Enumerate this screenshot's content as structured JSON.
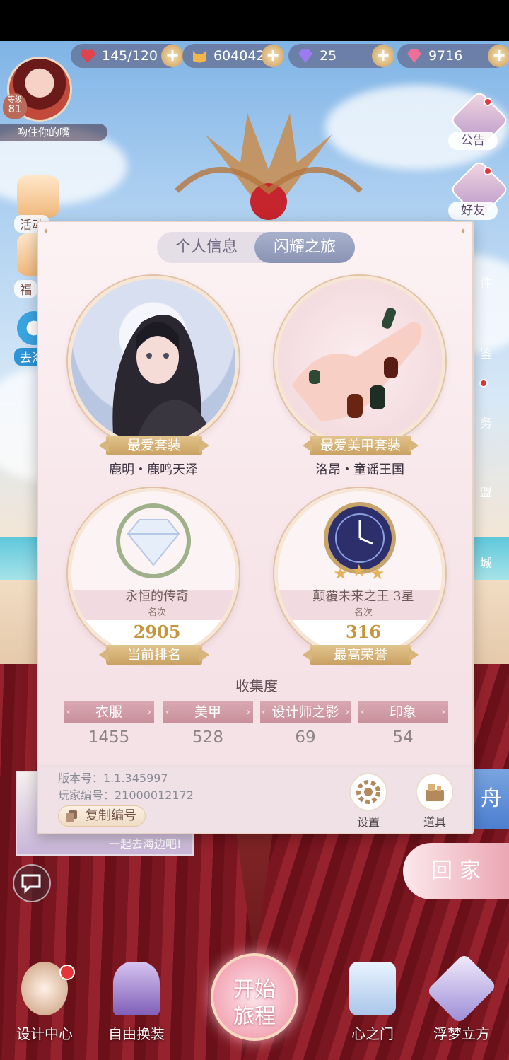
{
  "resources": [
    {
      "name": "stamina",
      "value": "145/120",
      "icon": "heart-icon",
      "color": "#e0434d"
    },
    {
      "name": "gold",
      "value": "604042",
      "icon": "cat-coin-icon",
      "color": "#f0b64a"
    },
    {
      "name": "diamond",
      "value": "25",
      "icon": "diamond-icon",
      "color": "#9a7cf0"
    },
    {
      "name": "crystal",
      "value": "9716",
      "icon": "pink-diamond-icon",
      "color": "#ef6f9b"
    }
  ],
  "player": {
    "level_label": "等级",
    "level": "81",
    "nickname": "吻住你的嘴"
  },
  "side_menu": [
    {
      "label": "公告",
      "icon": "notice-board-icon",
      "has_dot": true
    },
    {
      "label": "好友",
      "icon": "friend-icon",
      "has_dot": true
    }
  ],
  "side_partial": [
    "件",
    "鉴",
    "务",
    "盟",
    "城"
  ],
  "left_menu": [
    {
      "label": "活动",
      "icon": "event-icon"
    },
    {
      "label": "福",
      "icon": "gift-icon"
    },
    {
      "label": "去海",
      "icon": "float-ring-icon"
    }
  ],
  "panel": {
    "tabs": [
      {
        "label": "个人信息",
        "active": false
      },
      {
        "label": "闪耀之旅",
        "active": true
      }
    ],
    "favorites": [
      {
        "ribbon": "最爱套装",
        "name": "鹿明・鹿鸣天泽"
      },
      {
        "ribbon": "最爱美甲套装",
        "name": "洛昂・童谣王国"
      }
    ],
    "ranks": [
      {
        "title": "永恒的传奇",
        "sub": "名次",
        "value": "2905",
        "ribbon": "当前排名"
      },
      {
        "title": "颠覆未来之王 3星",
        "sub": "名次",
        "value": "316",
        "ribbon": "最高荣誉"
      }
    ],
    "collection_title": "收集度",
    "collection": [
      {
        "label": "衣服",
        "value": "1455"
      },
      {
        "label": "美甲",
        "value": "528"
      },
      {
        "label": "设计师之影",
        "value": "69"
      },
      {
        "label": "印象",
        "value": "54"
      }
    ],
    "footer": {
      "version": "版本号：1.1.345997",
      "player_id": "玩家编号：21000012172",
      "copy_label": "复制编号",
      "settings_label": "设置",
      "items_label": "道具"
    }
  },
  "behind": {
    "zhou_char": "舟",
    "mini_card_text": "一起去海边吧!"
  },
  "go_home_label": "回家",
  "bottom_nav": [
    {
      "label": "设计中心",
      "icon": "sewing-machine-icon"
    },
    {
      "label": "自由换装",
      "icon": "mirror-icon"
    },
    {
      "label": "心之门",
      "icon": "heart-door-icon"
    },
    {
      "label": "浮梦立方",
      "icon": "dream-cube-icon"
    }
  ],
  "start": {
    "line1": "开始",
    "line2": "旅程"
  }
}
